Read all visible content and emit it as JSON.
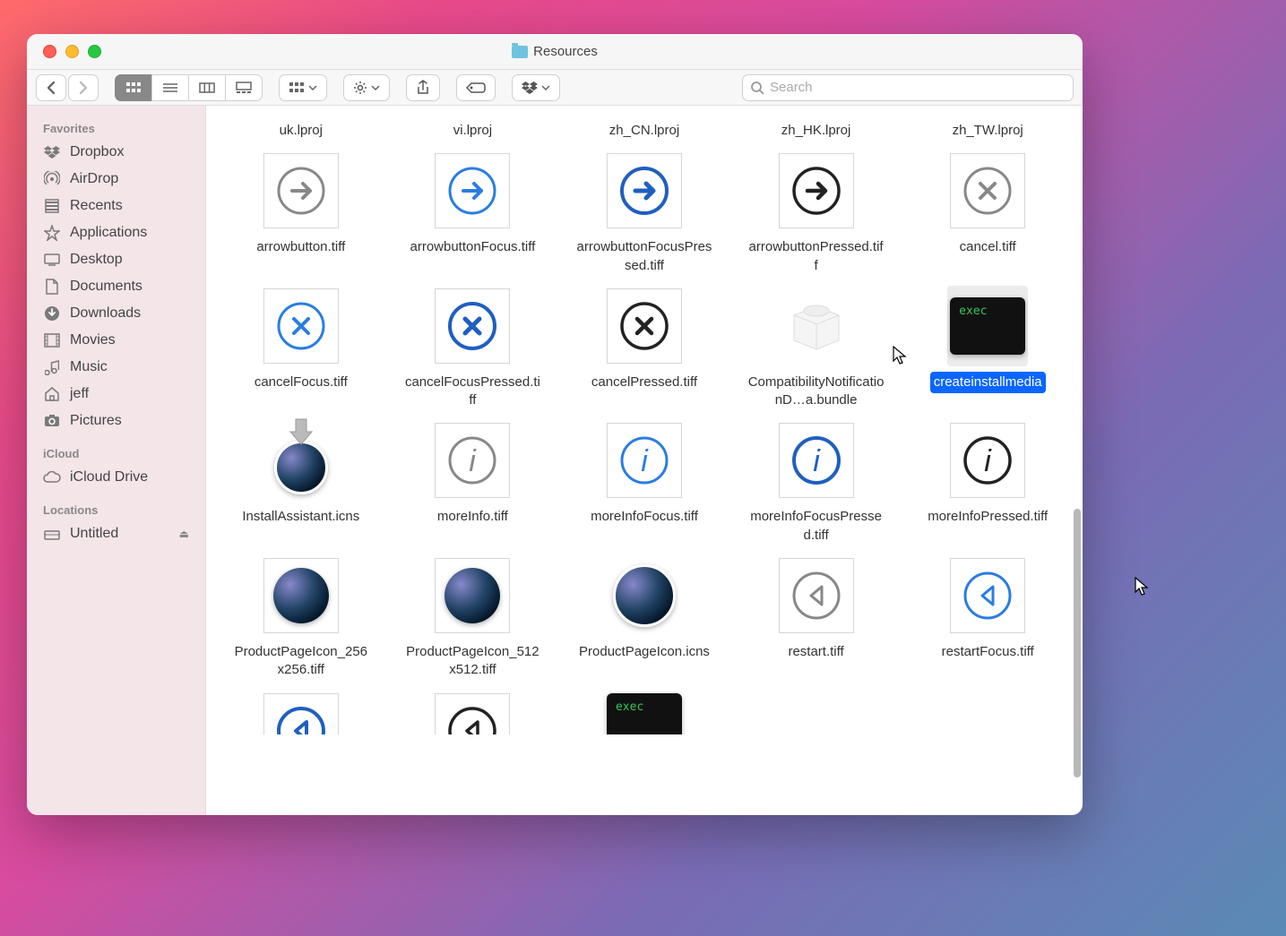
{
  "window": {
    "title": "Resources"
  },
  "toolbar": {
    "search_placeholder": "Search"
  },
  "sidebar": {
    "sections": [
      {
        "header": "Favorites",
        "items": [
          {
            "icon": "dropbox",
            "label": "Dropbox"
          },
          {
            "icon": "airdrop",
            "label": "AirDrop"
          },
          {
            "icon": "recents",
            "label": "Recents"
          },
          {
            "icon": "applications",
            "label": "Applications"
          },
          {
            "icon": "desktop",
            "label": "Desktop"
          },
          {
            "icon": "documents",
            "label": "Documents"
          },
          {
            "icon": "downloads",
            "label": "Downloads"
          },
          {
            "icon": "movies",
            "label": "Movies"
          },
          {
            "icon": "music",
            "label": "Music"
          },
          {
            "icon": "home",
            "label": "jeff"
          },
          {
            "icon": "pictures",
            "label": "Pictures"
          }
        ]
      },
      {
        "header": "iCloud",
        "items": [
          {
            "icon": "cloud",
            "label": "iCloud Drive"
          }
        ]
      },
      {
        "header": "Locations",
        "items": [
          {
            "icon": "disk",
            "label": "Untitled",
            "eject": true
          }
        ]
      }
    ]
  },
  "files": {
    "toprow": [
      {
        "label": "uk.lproj"
      },
      {
        "label": "vi.lproj"
      },
      {
        "label": "zh_CN.lproj"
      },
      {
        "label": "zh_HK.lproj"
      },
      {
        "label": "zh_TW.lproj"
      }
    ],
    "row1": [
      {
        "label": "arrowbutton.tiff",
        "kind": "circle-arrow",
        "color": "gray"
      },
      {
        "label": "arrowbuttonFocus.tiff",
        "kind": "circle-arrow",
        "color": "blue"
      },
      {
        "label": "arrowbuttonFocusPressed.tiff",
        "kind": "circle-arrow",
        "color": "blue-bold"
      },
      {
        "label": "arrowbuttonPressed.tiff",
        "kind": "circle-arrow",
        "color": "black"
      },
      {
        "label": "cancel.tiff",
        "kind": "circle-x",
        "color": "gray"
      }
    ],
    "row2": [
      {
        "label": "cancelFocus.tiff",
        "kind": "circle-x",
        "color": "blue"
      },
      {
        "label": "cancelFocusPressed.tiff",
        "kind": "circle-x",
        "color": "blue-bold"
      },
      {
        "label": "cancelPressed.tiff",
        "kind": "circle-x",
        "color": "black"
      },
      {
        "label": "CompatibilityNotificationD…a.bundle",
        "kind": "bundle"
      },
      {
        "label": "createinstallmedia",
        "kind": "exec",
        "selected": true
      }
    ],
    "row3": [
      {
        "label": "InstallAssistant.icns",
        "kind": "install-icns"
      },
      {
        "label": "moreInfo.tiff",
        "kind": "circle-i",
        "color": "gray"
      },
      {
        "label": "moreInfoFocus.tiff",
        "kind": "circle-i",
        "color": "blue"
      },
      {
        "label": "moreInfoFocusPressed.tiff",
        "kind": "circle-i",
        "color": "blue-bold"
      },
      {
        "label": "moreInfoPressed.tiff",
        "kind": "circle-i",
        "color": "black"
      }
    ],
    "row4": [
      {
        "label": "ProductPageIcon_256x256.tiff",
        "kind": "bigsur-tiff"
      },
      {
        "label": "ProductPageIcon_512x512.tiff",
        "kind": "bigsur-tiff"
      },
      {
        "label": "ProductPageIcon.icns",
        "kind": "bigsur-icns"
      },
      {
        "label": "restart.tiff",
        "kind": "circle-back",
        "color": "gray"
      },
      {
        "label": "restartFocus.tiff",
        "kind": "circle-back",
        "color": "blue"
      }
    ],
    "row5": [
      {
        "label": "",
        "kind": "circle-back",
        "color": "blue-bold"
      },
      {
        "label": "",
        "kind": "circle-back",
        "color": "black"
      },
      {
        "label": "",
        "kind": "exec"
      }
    ]
  }
}
